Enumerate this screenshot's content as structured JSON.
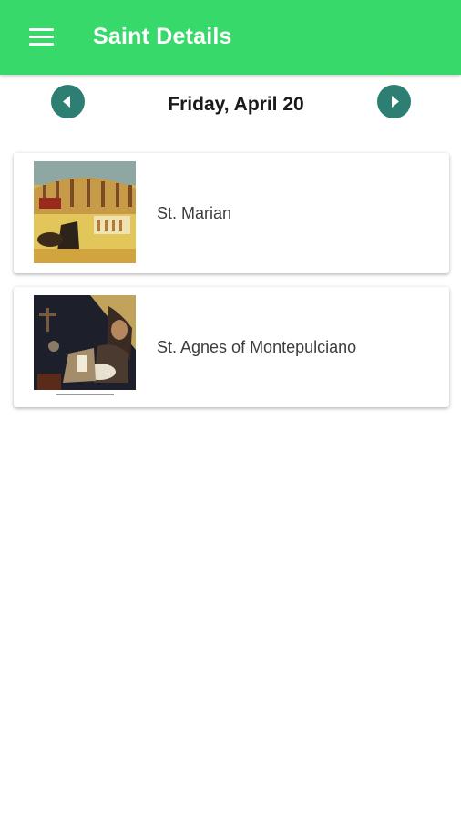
{
  "app_bar": {
    "title": "Saint Details",
    "background": "#38d96b",
    "menu_icon": "hamburger-menu-icon"
  },
  "date_nav": {
    "date": "Friday, April 20",
    "prev_icon": "arrow-left-circle-icon",
    "next_icon": "arrow-right-circle-icon",
    "button_color": "#2c7f72"
  },
  "saints": [
    {
      "name": "St. Marian",
      "image": "colosseum-painting"
    },
    {
      "name": "St. Agnes of Montepulciano",
      "image": "saint-agnes-painting"
    }
  ]
}
